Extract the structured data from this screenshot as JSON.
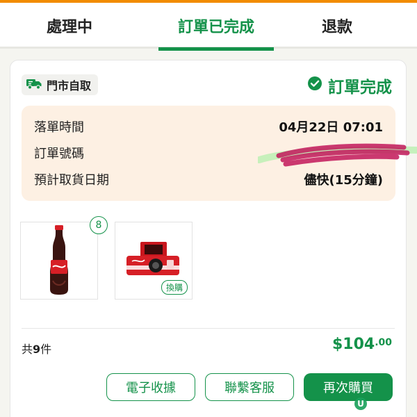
{
  "tabs": [
    {
      "label": "處理中",
      "active": false
    },
    {
      "label": "訂單已完成",
      "active": true
    },
    {
      "label": "退款",
      "active": false
    }
  ],
  "order": {
    "pickup_label": "門市自取",
    "status_label": "訂單完成",
    "rows": [
      {
        "label": "落單時間",
        "value": "04月22日 07:01"
      },
      {
        "label": "訂單號碼",
        "value": ""
      },
      {
        "label": "預計取貨日期",
        "value": "儘快(15分鐘)"
      }
    ],
    "items": [
      {
        "name": "coca-cola-bottle",
        "quantity_badge": "8",
        "tag": ""
      },
      {
        "name": "coca-cola-camera",
        "quantity_badge": "",
        "tag": "換購"
      }
    ],
    "count_prefix": "共",
    "count_value": "9",
    "count_suffix": "件",
    "total_main": "$104",
    "total_cents": ".00",
    "buttons": {
      "receipt": "電子收據",
      "contact": "聯繫客服",
      "reorder": "再次購買"
    }
  },
  "colors": {
    "accent": "#14924a",
    "top_bar": "#f28c00",
    "info_bg": "#fdf0e3",
    "redaction": "#c2185b"
  },
  "icons": {
    "pickup": "delivery-truck-icon",
    "status": "check-circle-icon",
    "watermark": "u-logo-icon"
  },
  "watermark_text": "U"
}
